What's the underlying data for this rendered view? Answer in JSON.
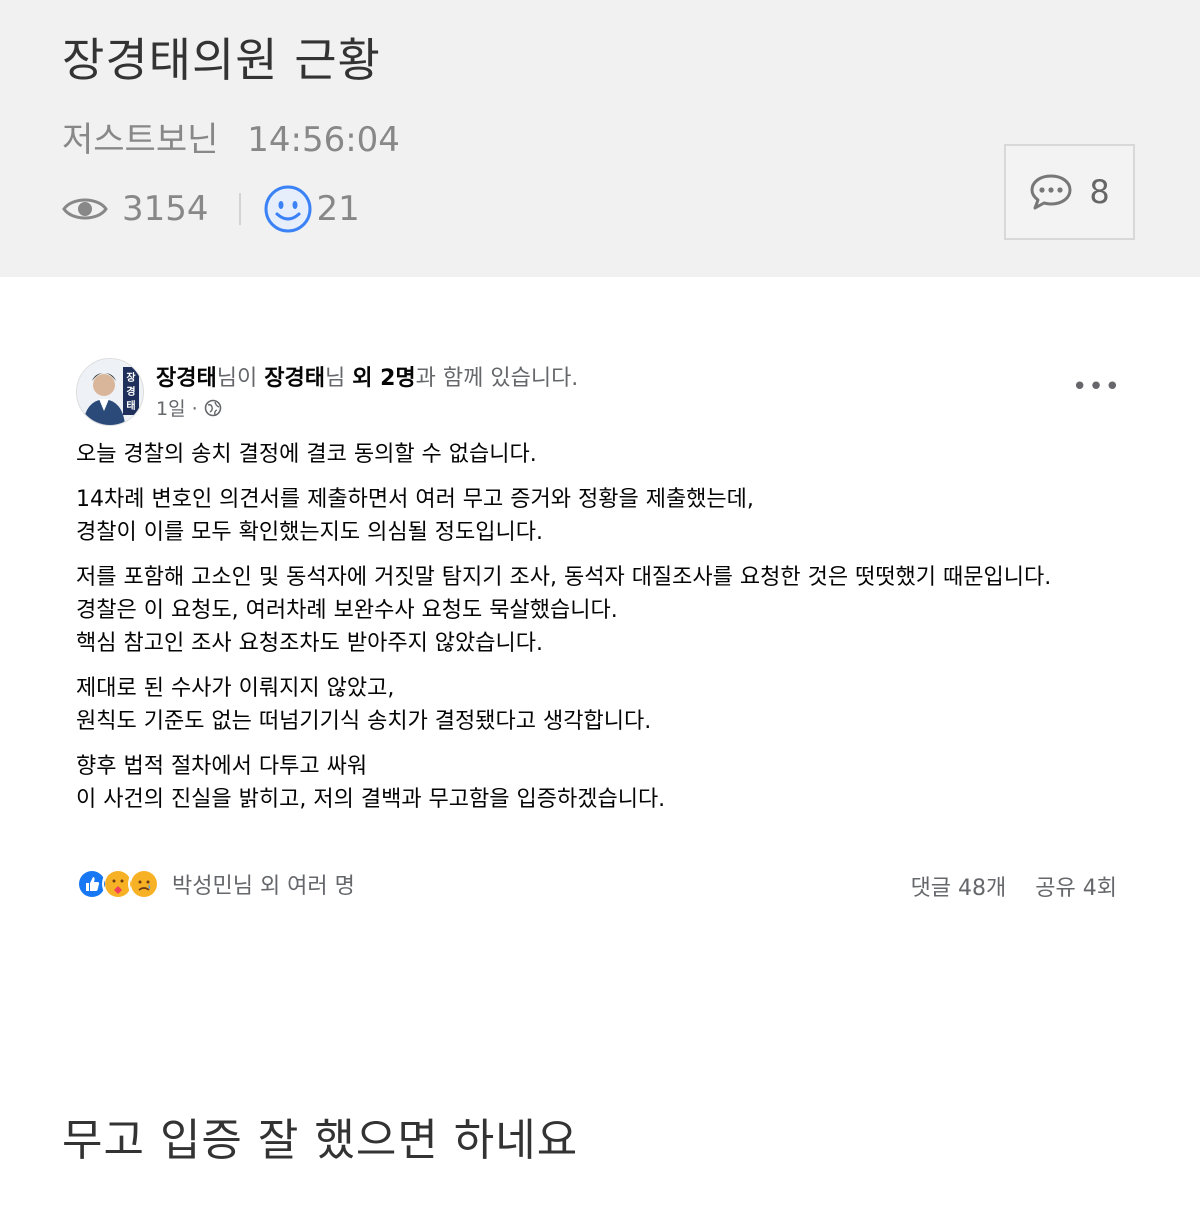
{
  "post": {
    "title": "장경태의원 근황",
    "author": "저스트보닌",
    "time": "14:56:04",
    "views": "3154",
    "likes": "21",
    "comments": "8"
  },
  "fb": {
    "author": "장경태",
    "author_suffix": "님이 ",
    "tagged": "장경태",
    "tagged_suffix": "님 ",
    "others": "외 2명",
    "others_suffix": "과 함께 있습니다.",
    "date": "1일 ·",
    "avatar_text": "장경태",
    "paragraphs": [
      "오늘 경찰의 송치 결정에 결코 동의할 수 없습니다.",
      "14차례 변호인 의견서를 제출하면서 여러 무고 증거와 정황을 제출했는데,\n경찰이 이를 모두 확인했는지도 의심될 정도입니다.",
      "저를 포함해 고소인 및 동석자에 거짓말 탐지기 조사, 동석자 대질조사를 요청한 것은 떳떳했기 때문입니다.\n경찰은 이 요청도, 여러차례 보완수사 요청도 묵살했습니다.\n핵심 참고인 조사 요청조차도 받아주지 않았습니다.",
      "제대로 된 수사가 이뤄지지 않았고,\n원칙도 기준도 없는 떠넘기기식 송치가 결정됐다고 생각합니다.",
      "향후 법적 절차에서 다투고 싸워\n이 사건의 진실을 밝히고, 저의 결백과 무고함을 입증하겠습니다."
    ],
    "reactions_text": "박성민님 외 여러 명",
    "comments_count": "댓글 48개",
    "shares_count": "공유 4회",
    "reaction_icons": [
      "like-icon",
      "care-icon",
      "sad-icon"
    ]
  },
  "reply": "무고 입증 잘 했으면 하네요",
  "colors": {
    "header_bg": "#f1f1f1",
    "fb_blue": "#1877f2",
    "smile_blue": "#3b82f6"
  }
}
